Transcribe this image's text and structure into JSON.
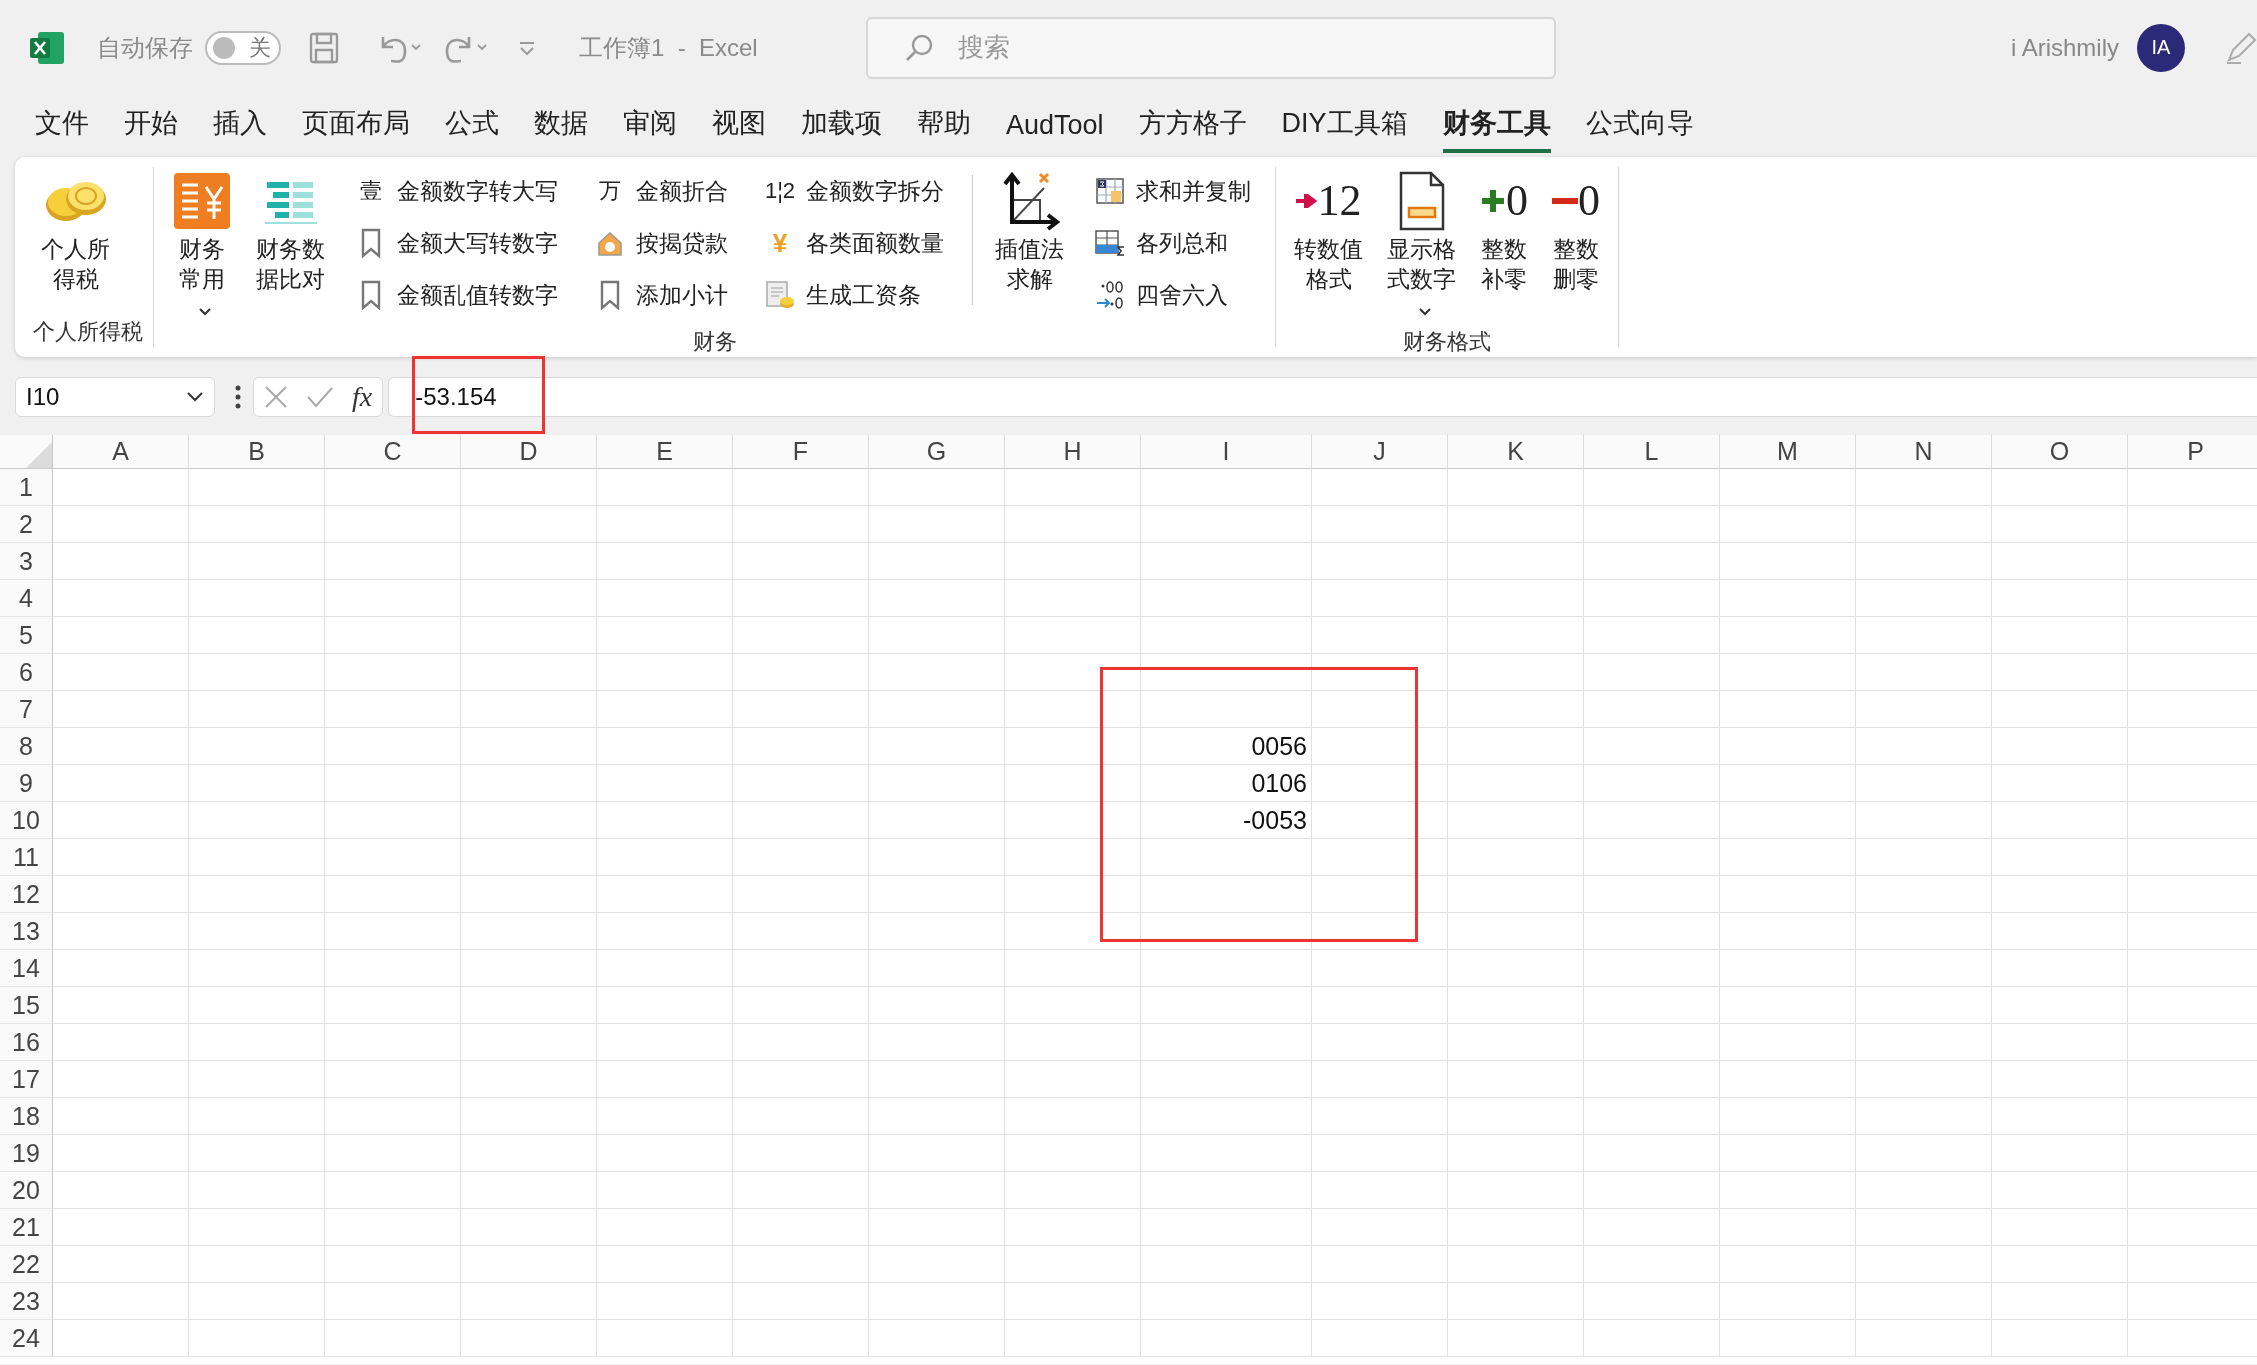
{
  "title_bar": {
    "autosave_label": "自动保存",
    "autosave": {
      "on": false,
      "label": "关"
    },
    "document_title": "工作簿1  -  Excel",
    "search": {
      "placeholder": "搜索"
    },
    "user_name": "i Arishmily",
    "avatar_initials": "IA"
  },
  "menu_tabs": [
    {
      "label": "文件",
      "selected": false
    },
    {
      "label": "开始",
      "selected": false
    },
    {
      "label": "插入",
      "selected": false
    },
    {
      "label": "页面布局",
      "selected": false
    },
    {
      "label": "公式",
      "selected": false
    },
    {
      "label": "数据",
      "selected": false
    },
    {
      "label": "审阅",
      "selected": false
    },
    {
      "label": "视图",
      "selected": false
    },
    {
      "label": "加载项",
      "selected": false
    },
    {
      "label": "帮助",
      "selected": false
    },
    {
      "label": "AudTool",
      "selected": false
    },
    {
      "label": "方方格子",
      "selected": false
    },
    {
      "label": "DIY工具箱",
      "selected": false
    },
    {
      "label": "财务工具",
      "selected": true
    },
    {
      "label": "公式向导",
      "selected": false
    }
  ],
  "ribbon": {
    "groups": [
      {
        "label": "个人所得税",
        "items": [
          {
            "kind": "large",
            "label": "个人所得税",
            "dropdown": false
          }
        ]
      },
      {
        "label": "财务",
        "items": [
          {
            "kind": "large",
            "label": "财务常用",
            "dropdown": true
          },
          {
            "kind": "large",
            "label": "财务数据比对",
            "dropdown": false
          },
          {
            "kind": "stack",
            "buttons": [
              {
                "label": "金额数字转大写",
                "glyph": "壹"
              },
              {
                "label": "金额大写转数字"
              },
              {
                "label": "金额乱值转数字"
              }
            ]
          },
          {
            "kind": "stack",
            "buttons": [
              {
                "label": "金额折合",
                "glyph": "万"
              },
              {
                "label": "按揭贷款"
              },
              {
                "label": "添加小计"
              }
            ]
          },
          {
            "kind": "stack",
            "buttons": [
              {
                "label": "金额数字拆分",
                "glyph": "1¦2"
              },
              {
                "label": "各类面额数量",
                "glyph": "¥"
              },
              {
                "label": "生成工资条"
              }
            ]
          },
          {
            "kind": "separator"
          },
          {
            "kind": "large",
            "label": "插值法求解",
            "dropdown": false
          },
          {
            "kind": "stack",
            "buttons": [
              {
                "label": "求和并复制"
              },
              {
                "label": "各列总和"
              },
              {
                "label": "四舍六入"
              }
            ]
          }
        ]
      },
      {
        "label": "财务格式",
        "items": [
          {
            "kind": "large",
            "label": "转数值格式",
            "glyph": "12",
            "dropdown": false
          },
          {
            "kind": "large",
            "label": "显示格式数字",
            "dropdown": true
          },
          {
            "kind": "large",
            "label": "整数补零",
            "glyph": "0",
            "dropdown": false
          },
          {
            "kind": "large",
            "label": "整数删零",
            "glyph": "0",
            "dropdown": false
          }
        ]
      }
    ]
  },
  "formula_bar": {
    "name_box": "I10",
    "fx": "fx",
    "value": "-53.154"
  },
  "sheet": {
    "columns": [
      "A",
      "B",
      "C",
      "D",
      "E",
      "F",
      "G",
      "H",
      "I",
      "J",
      "K",
      "L",
      "M",
      "N",
      "O",
      "P"
    ],
    "rows": [
      {
        "header": "1"
      },
      {
        "header": "2"
      },
      {
        "header": "3"
      },
      {
        "header": "4"
      },
      {
        "header": "5"
      },
      {
        "header": "6"
      },
      {
        "header": "7"
      },
      {
        "header": "8",
        "cells": [
          null,
          null,
          null,
          null,
          null,
          null,
          null,
          null,
          "0056"
        ]
      },
      {
        "header": "9",
        "cells": [
          null,
          null,
          null,
          null,
          null,
          null,
          null,
          null,
          "0106"
        ]
      },
      {
        "header": "10",
        "cells": [
          null,
          null,
          null,
          null,
          null,
          null,
          null,
          null,
          "-0053"
        ]
      },
      {
        "header": "11"
      },
      {
        "header": "12"
      },
      {
        "header": "13"
      },
      {
        "header": "14"
      },
      {
        "header": "15"
      },
      {
        "header": "16"
      },
      {
        "header": "17"
      },
      {
        "header": "18"
      },
      {
        "header": "19"
      },
      {
        "header": "20"
      },
      {
        "header": "21"
      },
      {
        "header": "22"
      },
      {
        "header": "23"
      },
      {
        "header": "24"
      }
    ]
  }
}
